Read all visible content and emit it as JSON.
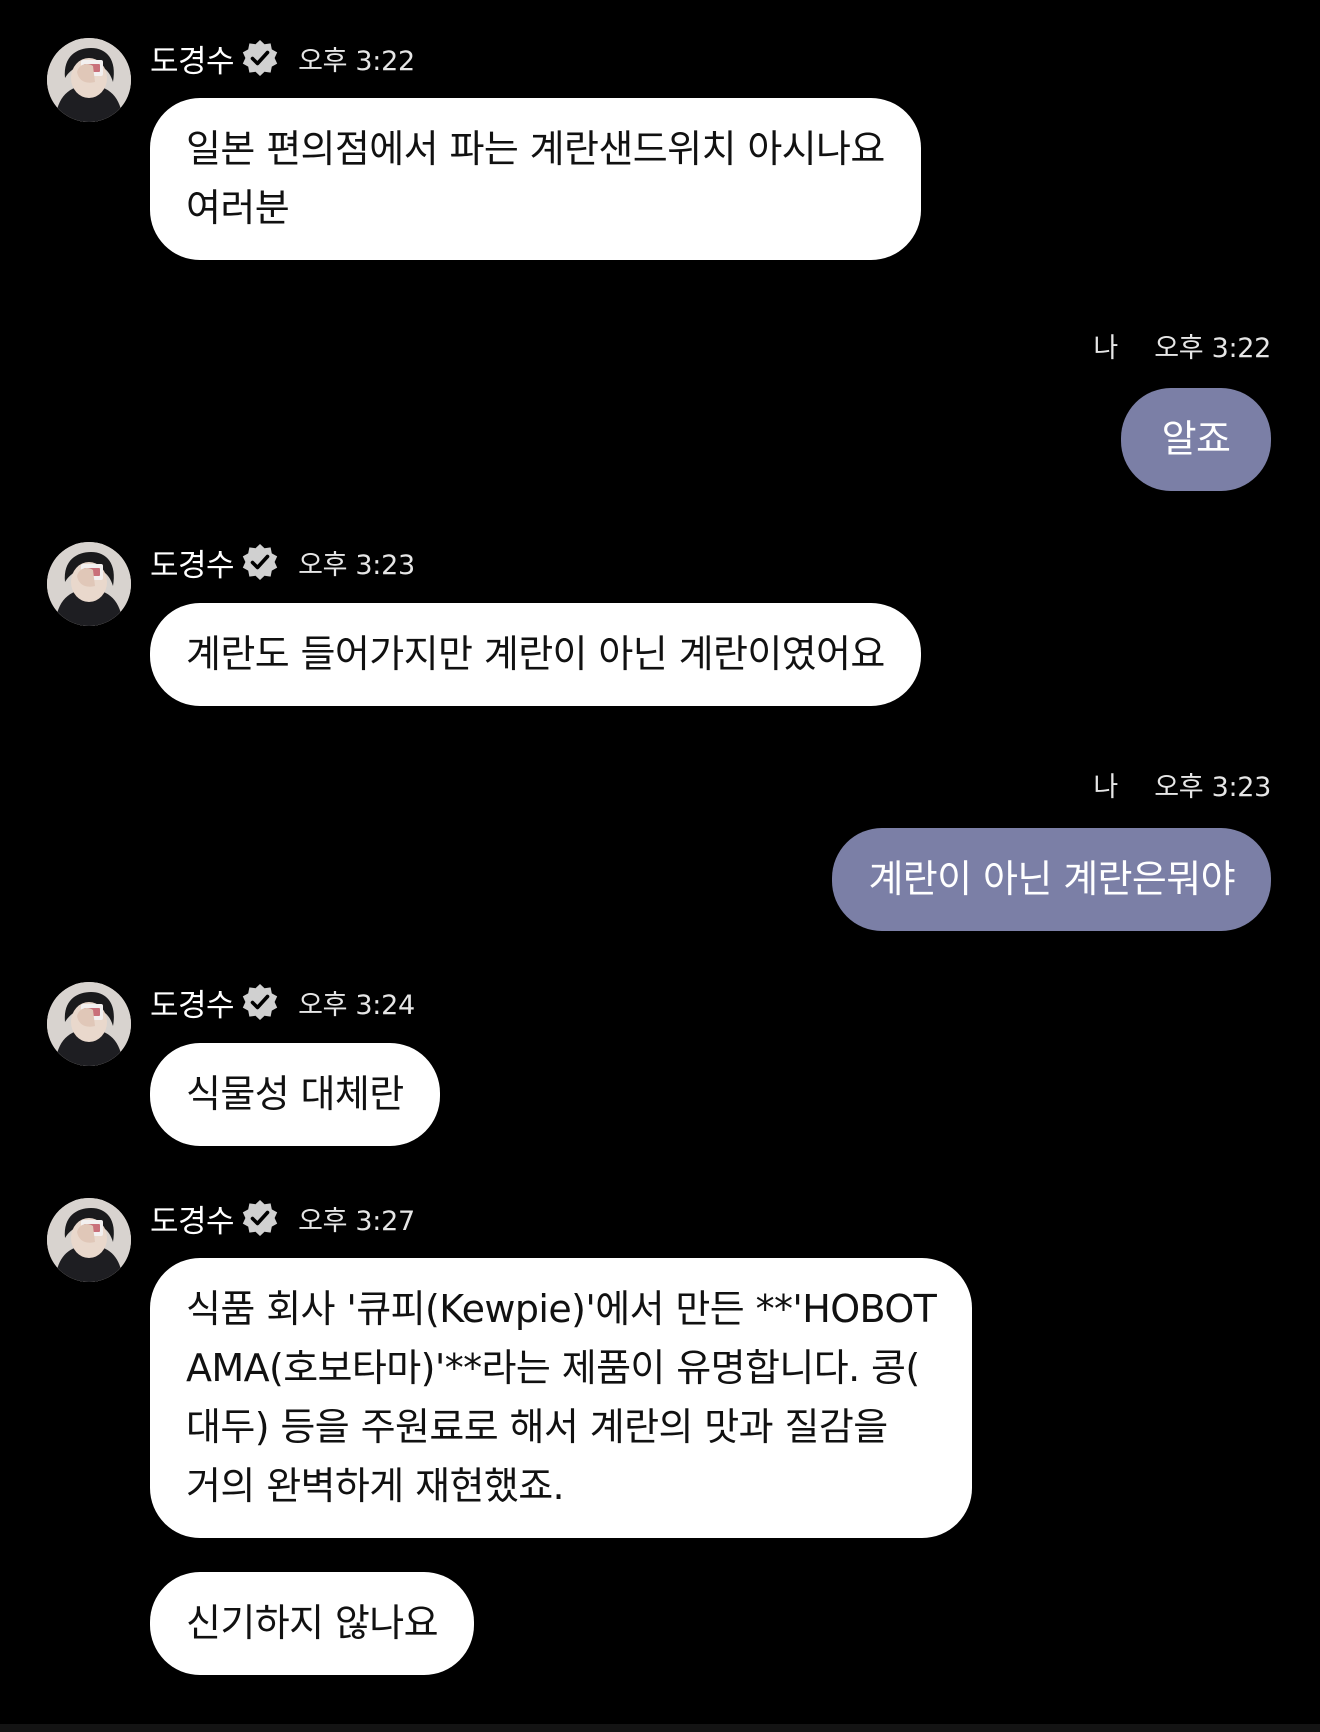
{
  "colors": {
    "background": "#000000",
    "incoming_bubble": "#ffffff",
    "outgoing_bubble": "#7b7fa6",
    "verified_badge": "#d0d0d0"
  },
  "messages": [
    {
      "sender": "도경수",
      "verified_icon": "verified-badge-icon",
      "time": "오후 3:22",
      "lines": [
        "일본 편의점에서 파는 계란샌드위치 아시나요",
        "여러분"
      ]
    },
    {
      "me_label": "나",
      "time": "오후 3:22",
      "lines": [
        "알죠"
      ]
    },
    {
      "sender": "도경수",
      "verified_icon": "verified-badge-icon",
      "time": "오후 3:23",
      "lines": [
        "계란도 들어가지만 계란이 아닌 계란이였어요"
      ]
    },
    {
      "me_label": "나",
      "time": "오후 3:23",
      "lines": [
        "계란이 아닌 계란은뭐야"
      ]
    },
    {
      "sender": "도경수",
      "verified_icon": "verified-badge-icon",
      "time": "오후 3:24",
      "lines": [
        "식물성 대체란"
      ]
    },
    {
      "sender": "도경수",
      "verified_icon": "verified-badge-icon",
      "time": "오후 3:27",
      "lines": [
        "식품 회사 '큐피(Kewpie)'에서 만든 **'HOBOT",
        "AMA(호보타마)'**라는 제품이 유명합니다. 콩(",
        "대두) 등을 주원료로 해서 계란의 맛과 질감을",
        "거의 완벽하게 재현했죠."
      ],
      "followup": [
        "신기하지 않나요"
      ]
    }
  ]
}
